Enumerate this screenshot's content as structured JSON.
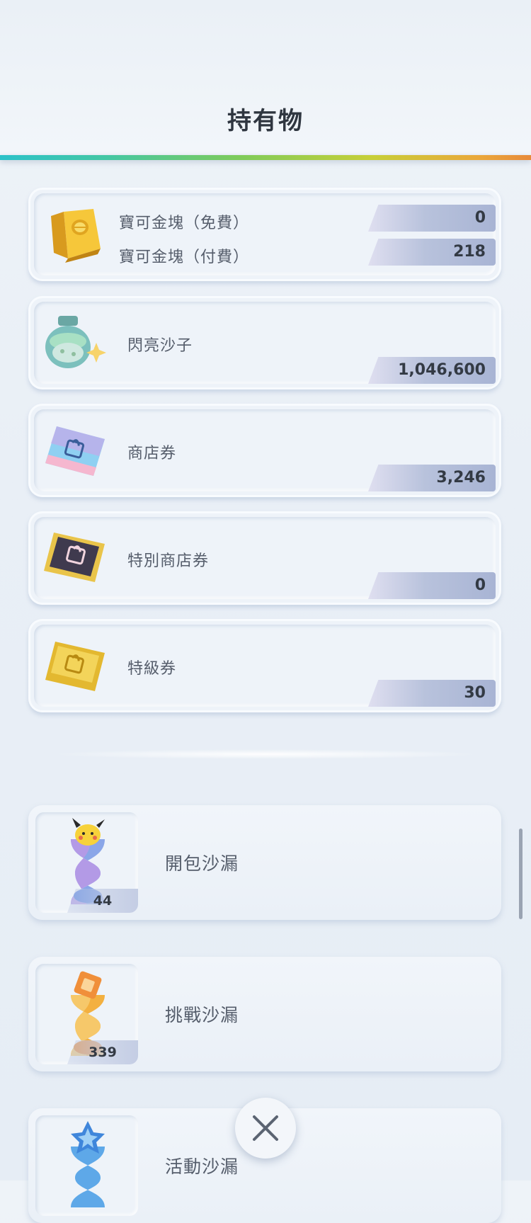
{
  "header": {
    "title": "持有物"
  },
  "currency": {
    "gold": {
      "free_label": "寶可金塊（免費）",
      "free_value": "0",
      "paid_label": "寶可金塊（付費）",
      "paid_value": "218"
    },
    "items": [
      {
        "label": "閃亮沙子",
        "value": "1,046,600",
        "icon": "shiny-sand-icon"
      },
      {
        "label": "商店券",
        "value": "3,246",
        "icon": "shop-ticket-icon"
      },
      {
        "label": "特別商店券",
        "value": "0",
        "icon": "special-shop-ticket-icon"
      },
      {
        "label": "特級券",
        "value": "30",
        "icon": "premium-ticket-icon"
      }
    ]
  },
  "hourglasses": [
    {
      "label": "開包沙漏",
      "count": "44",
      "icon": "pack-hourglass-icon"
    },
    {
      "label": "挑戰沙漏",
      "count": "339",
      "icon": "challenge-hourglass-icon"
    },
    {
      "label": "活動沙漏",
      "count": "",
      "icon": "event-hourglass-icon"
    }
  ],
  "controls": {
    "close_icon": "close-icon"
  },
  "colors": {
    "rainbow_start": "#2cc2c9",
    "rainbow_end": "#e88a3a",
    "title": "#2f3640"
  }
}
